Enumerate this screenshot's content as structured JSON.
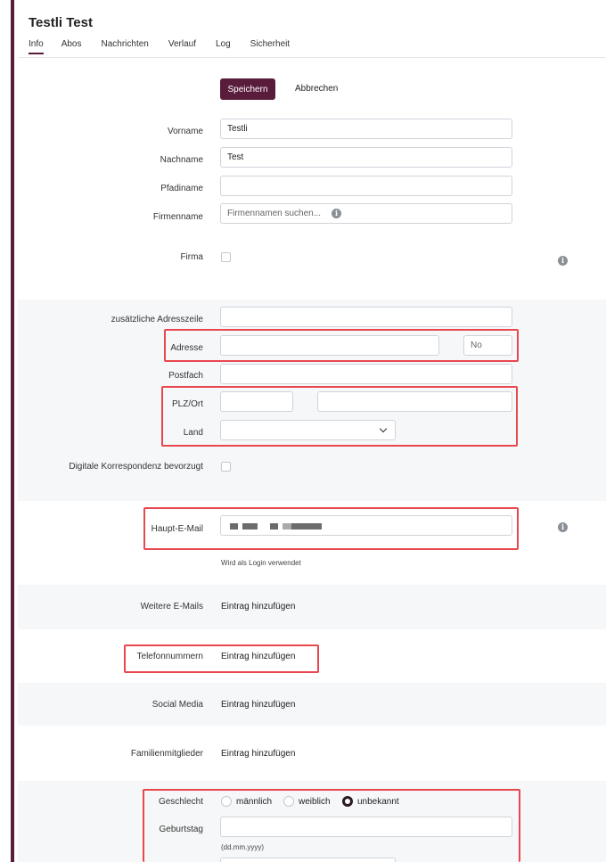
{
  "header": {
    "title": "Testli Test"
  },
  "tabs": [
    "Info",
    "Abos",
    "Nachrichten",
    "Verlauf",
    "Log",
    "Sicherheit"
  ],
  "actions": {
    "save": "Speichern",
    "cancel": "Abbrechen"
  },
  "fields": {
    "vorname": {
      "label": "Vorname",
      "value": "Testli"
    },
    "nachname": {
      "label": "Nachname",
      "value": "Test"
    },
    "pfadiname": {
      "label": "Pfadiname",
      "value": ""
    },
    "firmenname": {
      "label": "Firmenname",
      "placeholder": "Firmennamen suchen..."
    },
    "firma": {
      "label": "Firma"
    },
    "adresszeile": {
      "label": "zusätzliche Adresszeile",
      "value": ""
    },
    "adresse": {
      "label": "Adresse",
      "value": "",
      "number_placeholder": "No"
    },
    "postfach": {
      "label": "Postfach",
      "value": ""
    },
    "plz_ort": {
      "label": "PLZ/Ort"
    },
    "land": {
      "label": "Land"
    },
    "digital": {
      "label": "Digitale Korrespondenz bevorzugt"
    },
    "haupt_email": {
      "label": "Haupt-E-Mail",
      "hint": "Wird als Login verwendet"
    },
    "weitere_emails": {
      "label": "Weitere E-Mails",
      "link": "Eintrag hinzufügen"
    },
    "telefon": {
      "label": "Telefonnummern",
      "link": "Eintrag hinzufügen"
    },
    "social": {
      "label": "Social Media",
      "link": "Eintrag hinzufügen"
    },
    "familie": {
      "label": "Familienmitglieder",
      "link": "Eintrag hinzufügen"
    },
    "geschlecht": {
      "label": "Geschlecht",
      "options": [
        "männlich",
        "weiblich",
        "unbekannt"
      ],
      "selected": "unbekannt"
    },
    "geburtstag": {
      "label": "Geburtstag",
      "hint": "(dd.mm.yyyy)"
    }
  },
  "colors": {
    "accent": "#5a1c3b",
    "highlight": "#e8474f"
  }
}
